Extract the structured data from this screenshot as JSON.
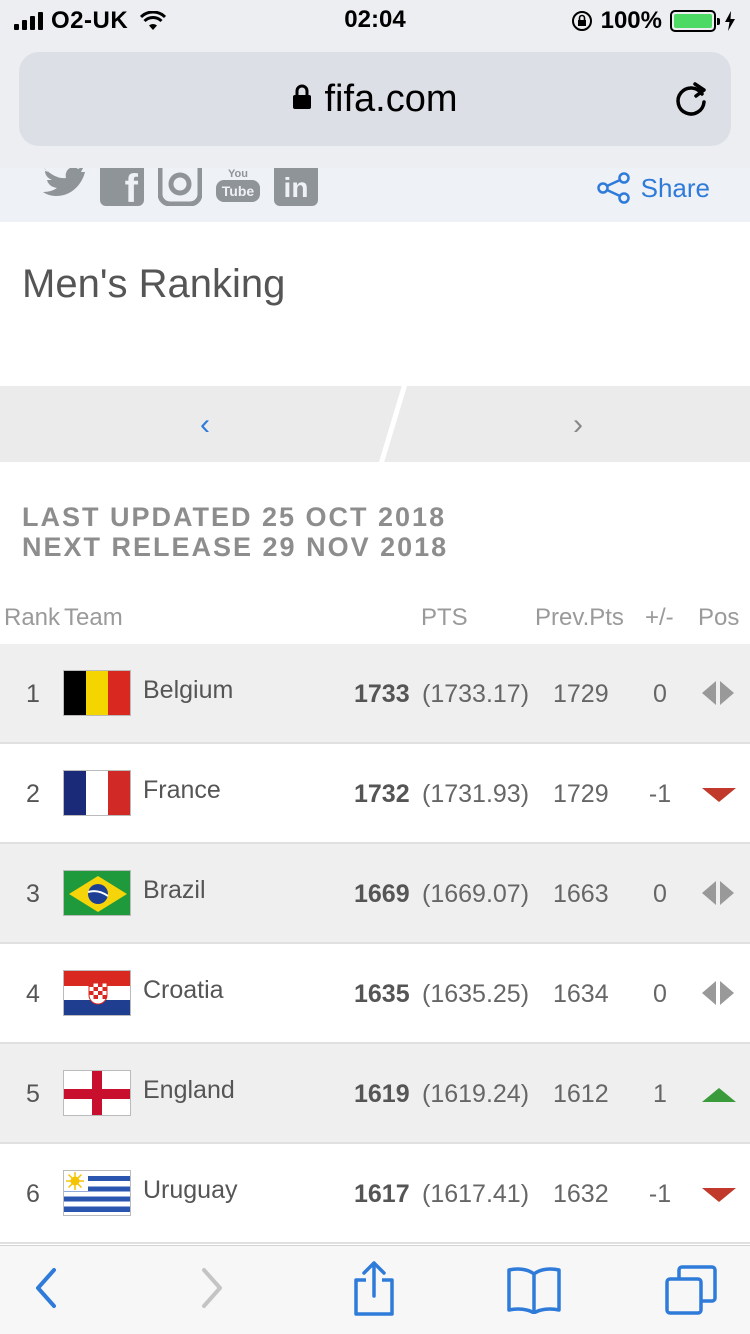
{
  "status_bar": {
    "carrier": "O2-UK",
    "time": "02:04",
    "battery": "100%"
  },
  "browser": {
    "url": "fifa.com"
  },
  "social": {
    "share_label": "Share",
    "youtube_top": "You",
    "youtube_bottom": "Tube",
    "linkedin": "in",
    "facebook": "f"
  },
  "page": {
    "title": "Men's Ranking",
    "pager_prev": "‹",
    "pager_next": "›",
    "last_updated": "LAST UPDATED 25 OCT 2018",
    "next_release": "NEXT RELEASE 29 NOV 2018"
  },
  "table": {
    "headers": {
      "rank": "Rank",
      "team": "Team",
      "pts": "PTS",
      "prev_pts": "Prev.Pts",
      "change": "+/-",
      "pos": "Pos"
    },
    "rows": [
      {
        "rank": "1",
        "team": "Belgium",
        "pts": "1733",
        "exact": "(1733.17)",
        "prev": "1729",
        "change": "0",
        "trend": "same"
      },
      {
        "rank": "2",
        "team": "France",
        "pts": "1732",
        "exact": "(1731.93)",
        "prev": "1729",
        "change": "-1",
        "trend": "down"
      },
      {
        "rank": "3",
        "team": "Brazil",
        "pts": "1669",
        "exact": "(1669.07)",
        "prev": "1663",
        "change": "0",
        "trend": "same"
      },
      {
        "rank": "4",
        "team": "Croatia",
        "pts": "1635",
        "exact": "(1635.25)",
        "prev": "1634",
        "change": "0",
        "trend": "same"
      },
      {
        "rank": "5",
        "team": "England",
        "pts": "1619",
        "exact": "(1619.24)",
        "prev": "1612",
        "change": "1",
        "trend": "up"
      },
      {
        "rank": "6",
        "team": "Uruguay",
        "pts": "1617",
        "exact": "(1617.41)",
        "prev": "1632",
        "change": "-1",
        "trend": "down"
      }
    ]
  },
  "colors": {
    "accent_blue": "#2f7bd9",
    "trend_down": "#c0392b",
    "trend_up": "#3a9b3a",
    "trend_same": "#999999",
    "battery_green": "#4cd964"
  },
  "toolbar_icons": [
    "back-icon",
    "forward-icon",
    "share-icon",
    "bookmarks-icon",
    "tabs-icon"
  ]
}
